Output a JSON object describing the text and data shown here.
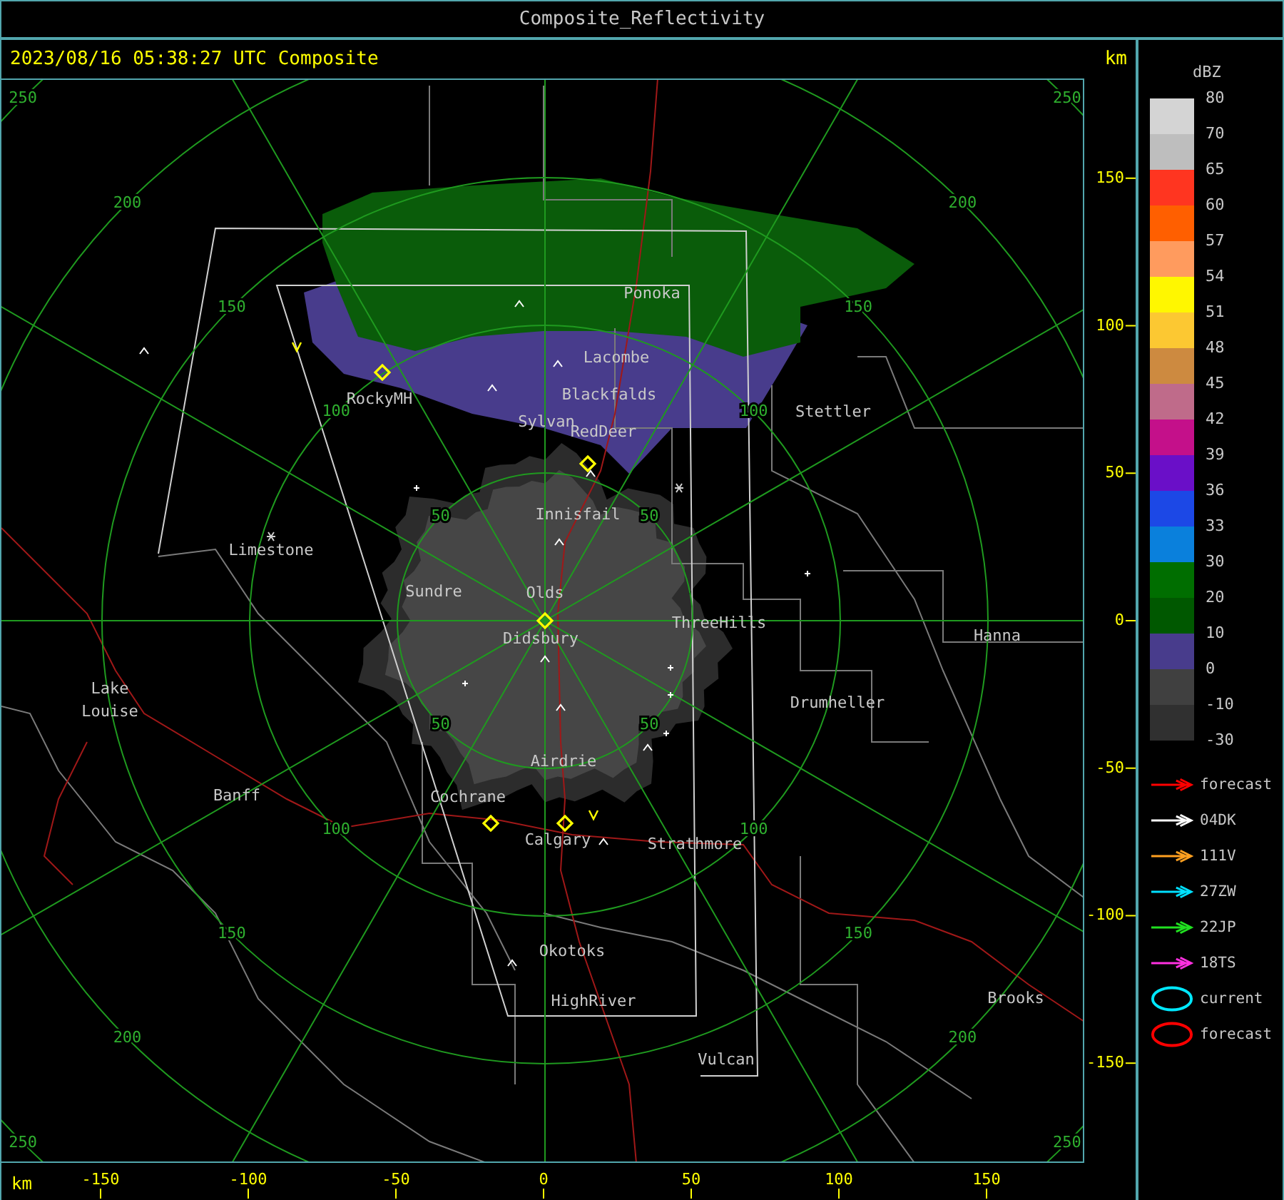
{
  "window": {
    "title": "Composite_Reflectivity"
  },
  "header": {
    "timestamp": "2023/08/16 05:38:27 UTC Composite",
    "unit": "km"
  },
  "map": {
    "cities": [
      {
        "name": "Ponoka"
      },
      {
        "name": "Lacombe"
      },
      {
        "name": "Blackfalds"
      },
      {
        "name": "Sylvan"
      },
      {
        "name": "RedDeer"
      },
      {
        "name": "RockyMH"
      },
      {
        "name": "Stettler"
      },
      {
        "name": "Innisfail"
      },
      {
        "name": "Limestone"
      },
      {
        "name": "Sundre"
      },
      {
        "name": "Olds"
      },
      {
        "name": "Didsbury"
      },
      {
        "name": "ThreeHills"
      },
      {
        "name": "Hanna"
      },
      {
        "name": "Lake Louise"
      },
      {
        "name": "Drumheller"
      },
      {
        "name": "Airdrie"
      },
      {
        "name": "Banff"
      },
      {
        "name": "Cochrane"
      },
      {
        "name": "Calgary"
      },
      {
        "name": "Strathmore"
      },
      {
        "name": "Okotoks"
      },
      {
        "name": "HighRiver"
      },
      {
        "name": "Brooks"
      },
      {
        "name": "Vulcan"
      }
    ],
    "range_rings": [
      {
        "labels": [
          "50",
          "50",
          "50",
          "50"
        ]
      },
      {
        "labels": [
          "100",
          "100",
          "100",
          "100"
        ]
      },
      {
        "labels": [
          "150",
          "150",
          "150",
          "150"
        ]
      },
      {
        "labels": [
          "200",
          "200",
          "200",
          "200"
        ]
      },
      {
        "labels": [
          "250",
          "250",
          "250",
          "250"
        ]
      }
    ]
  },
  "y_axis": {
    "ticks": [
      "150",
      "100",
      "50",
      "0",
      "-50",
      "-100",
      "-150"
    ]
  },
  "x_axis": {
    "unit": "km",
    "ticks": [
      "-150",
      "-100",
      "-50",
      "0",
      "50",
      "100",
      "150"
    ]
  },
  "legend": {
    "title": "dBZ",
    "scale": [
      {
        "label": "80",
        "color": "#d4d4d4"
      },
      {
        "label": "70",
        "color": "#bebebe"
      },
      {
        "label": "65",
        "color": "#ff3520"
      },
      {
        "label": "60",
        "color": "#ff5f00"
      },
      {
        "label": "57",
        "color": "#ff9b5e"
      },
      {
        "label": "54",
        "color": "#fff700"
      },
      {
        "label": "51",
        "color": "#fcc832"
      },
      {
        "label": "48",
        "color": "#cd8a40"
      },
      {
        "label": "45",
        "color": "#bf6b8a"
      },
      {
        "label": "42",
        "color": "#c4108a"
      },
      {
        "label": "39",
        "color": "#6a0fc8"
      },
      {
        "label": "36",
        "color": "#1c48e6"
      },
      {
        "label": "33",
        "color": "#0a80dc"
      },
      {
        "label": "30",
        "color": "#006e00"
      },
      {
        "label": "20",
        "color": "#005800"
      },
      {
        "label": "10",
        "color": "#483c8c"
      },
      {
        "label": "0",
        "color": "#404040"
      },
      {
        "label": "-10",
        "color": "#303030"
      }
    ],
    "bottom_label": "-30",
    "tracks": [
      {
        "kind": "arrow",
        "color": "#ff0000",
        "label": "forecast"
      },
      {
        "kind": "arrow",
        "color": "#ffffff",
        "label": "04DK"
      },
      {
        "kind": "arrow",
        "color": "#ffa020",
        "label": "111V"
      },
      {
        "kind": "arrow",
        "color": "#00e0ff",
        "label": "27ZW"
      },
      {
        "kind": "arrow",
        "color": "#20e020",
        "label": "22JP"
      },
      {
        "kind": "arrow",
        "color": "#ff30e0",
        "label": "18TS"
      },
      {
        "kind": "ellipse",
        "color": "#00e8ff",
        "label": "current"
      },
      {
        "kind": "ellipse",
        "color": "#ff0000",
        "label": "forecast"
      }
    ]
  }
}
